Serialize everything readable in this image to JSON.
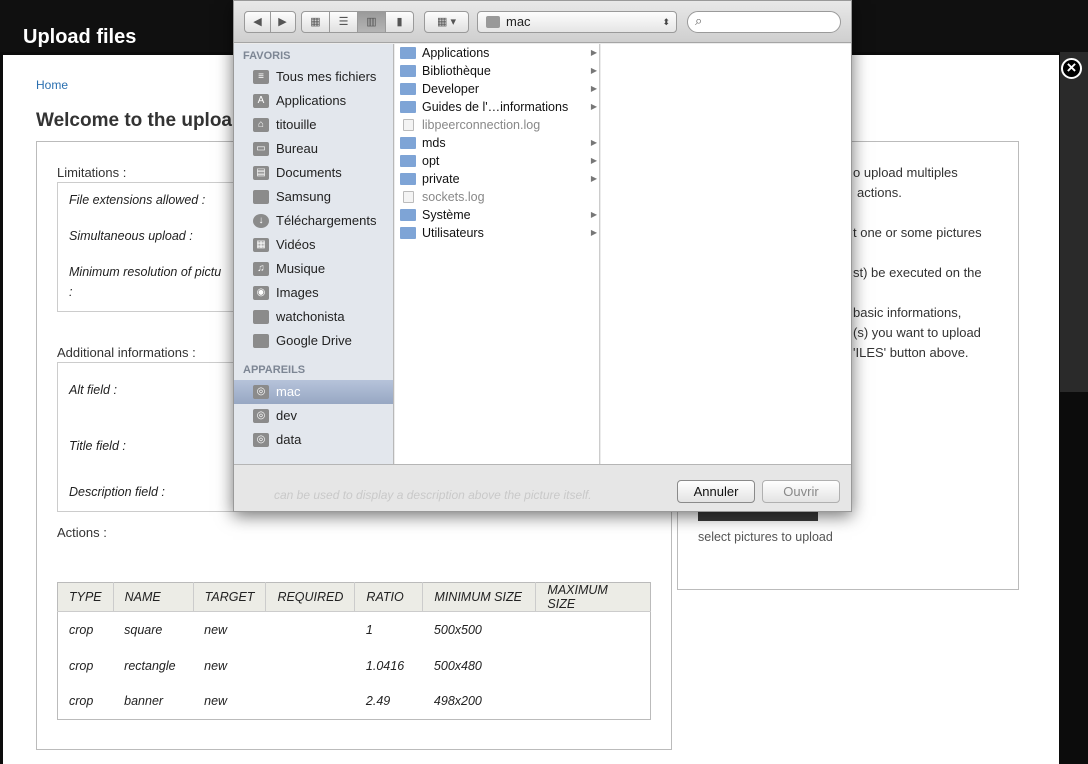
{
  "window": {
    "title": "Upload files"
  },
  "page": {
    "breadcrumb": "Home",
    "welcome": "Welcome to the uploa",
    "limitations": {
      "label": "Limitations :",
      "file_ext": "File extensions allowed :",
      "simultaneous": "Simultaneous upload :",
      "min_res": "Minimum resolution of pictu",
      "min_res_colon": ":"
    },
    "additional": {
      "label": "Additional informations :",
      "alt": "Alt field :",
      "title": "Title field :",
      "description": "Description field :",
      "description_hint": "can be used to display a description above the picture itself."
    },
    "actions": {
      "label": "Actions :",
      "headers": [
        "TYPE",
        "NAME",
        "TARGET",
        "REQUIRED",
        "RATIO",
        "MINIMUM SIZE",
        "MAXIMUM SIZE"
      ],
      "rows": [
        {
          "type": "crop",
          "name": "square",
          "target": "new",
          "required": "",
          "ratio": "1",
          "min": "500x500",
          "max": ""
        },
        {
          "type": "crop",
          "name": "rectangle",
          "target": "new",
          "required": "",
          "ratio": "1.0416",
          "min": "500x480",
          "max": ""
        },
        {
          "type": "crop",
          "name": "banner",
          "target": "new",
          "required": "",
          "ratio": "2.49",
          "min": "498x200",
          "max": ""
        }
      ]
    },
    "right": {
      "lines": [
        "o upload multiples",
        "actions.",
        "t one or some pictures",
        "st) be executed on the",
        "basic informations,",
        "(s) you want to upload",
        "'ILES' button above."
      ],
      "select_text": "select pictures to upload"
    }
  },
  "dialog": {
    "path": "mac",
    "search_placeholder": "",
    "sidebar": {
      "favoris_header": "FAVORIS",
      "favoris": [
        {
          "label": "Tous mes fichiers",
          "icon": "all-files-icon"
        },
        {
          "label": "Applications",
          "icon": "applications-icon"
        },
        {
          "label": "titouille",
          "icon": "home-icon"
        },
        {
          "label": "Bureau",
          "icon": "desktop-icon"
        },
        {
          "label": "Documents",
          "icon": "documents-icon"
        },
        {
          "label": "Samsung",
          "icon": "folder-icon"
        },
        {
          "label": "Téléchargements",
          "icon": "downloads-icon"
        },
        {
          "label": "Vidéos",
          "icon": "movies-icon"
        },
        {
          "label": "Musique",
          "icon": "music-icon"
        },
        {
          "label": "Images",
          "icon": "camera-icon"
        },
        {
          "label": "watchonista",
          "icon": "folder-icon"
        },
        {
          "label": "Google Drive",
          "icon": "folder-icon"
        }
      ],
      "appareils_header": "APPAREILS",
      "appareils": [
        {
          "label": "mac",
          "icon": "disk-icon"
        },
        {
          "label": "dev",
          "icon": "disk-icon"
        },
        {
          "label": "data",
          "icon": "disk-icon"
        }
      ]
    },
    "files": [
      {
        "name": "Applications",
        "kind": "folder",
        "arrow": "▶"
      },
      {
        "name": "Bibliothèque",
        "kind": "folder",
        "arrow": "▶"
      },
      {
        "name": "Developer",
        "kind": "folder",
        "arrow": "▶"
      },
      {
        "name": "Guides de l'…informations",
        "kind": "folder",
        "arrow": "▶"
      },
      {
        "name": "libpeerconnection.log",
        "kind": "file",
        "arrow": ""
      },
      {
        "name": "mds",
        "kind": "folder",
        "arrow": "▶"
      },
      {
        "name": "opt",
        "kind": "folder",
        "arrow": "▶"
      },
      {
        "name": "private",
        "kind": "folder",
        "arrow": "▶"
      },
      {
        "name": "sockets.log",
        "kind": "file",
        "arrow": ""
      },
      {
        "name": "Système",
        "kind": "folder",
        "arrow": "▶"
      },
      {
        "name": "Utilisateurs",
        "kind": "folder",
        "arrow": "▶"
      }
    ],
    "buttons": {
      "cancel": "Annuler",
      "open": "Ouvrir"
    }
  }
}
